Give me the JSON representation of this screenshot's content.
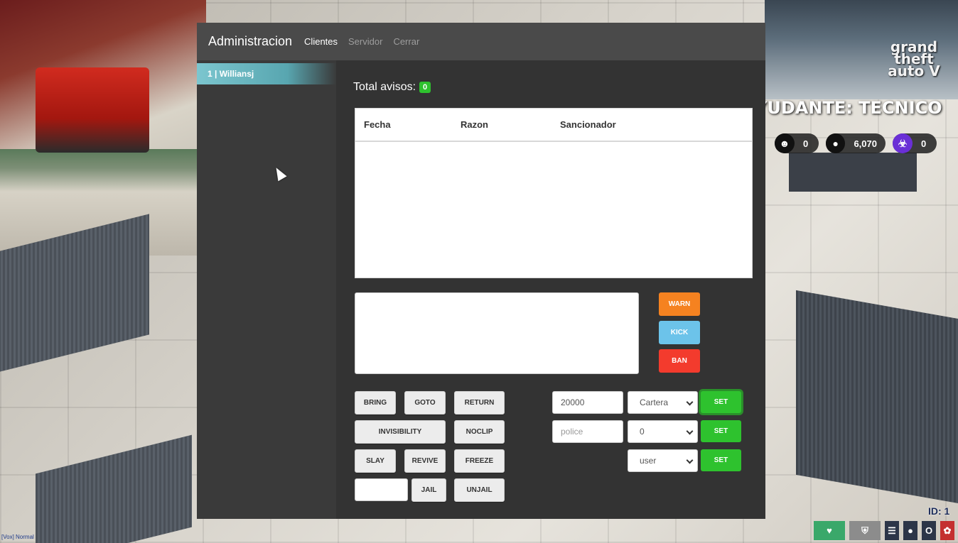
{
  "navbar": {
    "brand": "Administracion",
    "tabs": [
      {
        "label": "Clientes",
        "active": true
      },
      {
        "label": "Servidor",
        "active": false
      },
      {
        "label": "Cerrar",
        "active": false
      }
    ]
  },
  "sidebar": {
    "items": [
      {
        "label": "1 | Williansj"
      }
    ]
  },
  "main": {
    "total_label": "Total avisos:",
    "total_count": "0",
    "table": {
      "columns": [
        "Fecha",
        "Razon",
        "Sancionador"
      ],
      "rows": []
    },
    "reason_value": "",
    "actions": {
      "warn": "WARN",
      "kick": "KICK",
      "ban": "BAN"
    },
    "buttons": {
      "bring": "BRING",
      "goto": "GOTO",
      "return": "RETURN",
      "invisibility": "INVISIBILITY",
      "noclip": "NOCLIP",
      "slay": "SLAY",
      "revive": "REVIVE",
      "freeze": "FREEZE",
      "jail": "JAIL",
      "unjail": "UNJAIL"
    },
    "jail_time_value": "",
    "money": {
      "amount_value": "20000",
      "account_selected": "Cartera",
      "set_label": "SET"
    },
    "job": {
      "job_placeholder": "police",
      "grade_selected": "0",
      "set_label": "SET"
    },
    "group": {
      "group_selected": "user",
      "set_label": "SET"
    }
  },
  "hud": {
    "job_text": "YUDANTE: TECNICO",
    "logo_lines": [
      "grand",
      "theft",
      "auto V"
    ],
    "stats": [
      {
        "icon": "user-icon",
        "value": "0"
      },
      {
        "icon": "piggy-bank-icon",
        "value": "6,070"
      },
      {
        "icon": "biohazard-icon",
        "value": "0"
      }
    ],
    "id_label": "ID: 1",
    "voice_label": "[Vox] Normal",
    "status_icons": [
      "heart-icon",
      "shield-icon",
      "burger-icon",
      "water-drop-icon",
      "oxygen-icon",
      "brain-icon"
    ]
  },
  "colors": {
    "panel_bg": "#333333",
    "navbar_bg": "#4a4a4a",
    "sidebar_active": "#7cc6cf",
    "warn": "#f58220",
    "kick": "#6cc3ea",
    "ban": "#f33b2d",
    "set": "#2ec22e",
    "badge": "#2ec22e"
  }
}
